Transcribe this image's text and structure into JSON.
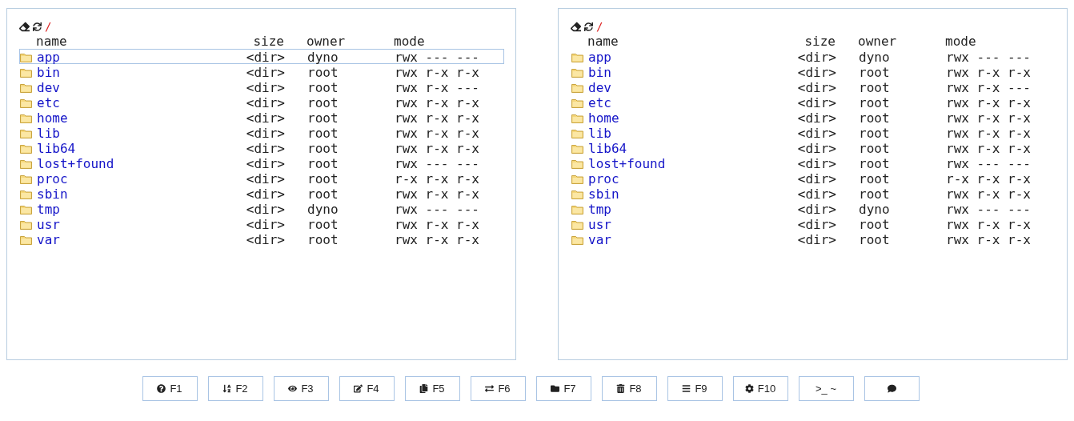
{
  "panels": [
    {
      "path": "/",
      "columns": [
        "name",
        "size",
        "owner",
        "mode"
      ],
      "rows": [
        {
          "name": "app",
          "size": "<dir>",
          "owner": "dyno",
          "mode": "rwx --- ---",
          "selected": true
        },
        {
          "name": "bin",
          "size": "<dir>",
          "owner": "root",
          "mode": "rwx r-x r-x",
          "selected": false
        },
        {
          "name": "dev",
          "size": "<dir>",
          "owner": "root",
          "mode": "rwx r-x ---",
          "selected": false
        },
        {
          "name": "etc",
          "size": "<dir>",
          "owner": "root",
          "mode": "rwx r-x r-x",
          "selected": false
        },
        {
          "name": "home",
          "size": "<dir>",
          "owner": "root",
          "mode": "rwx r-x r-x",
          "selected": false
        },
        {
          "name": "lib",
          "size": "<dir>",
          "owner": "root",
          "mode": "rwx r-x r-x",
          "selected": false
        },
        {
          "name": "lib64",
          "size": "<dir>",
          "owner": "root",
          "mode": "rwx r-x r-x",
          "selected": false
        },
        {
          "name": "lost+found",
          "size": "<dir>",
          "owner": "root",
          "mode": "rwx --- ---",
          "selected": false
        },
        {
          "name": "proc",
          "size": "<dir>",
          "owner": "root",
          "mode": "r-x r-x r-x",
          "selected": false
        },
        {
          "name": "sbin",
          "size": "<dir>",
          "owner": "root",
          "mode": "rwx r-x r-x",
          "selected": false
        },
        {
          "name": "tmp",
          "size": "<dir>",
          "owner": "dyno",
          "mode": "rwx --- ---",
          "selected": false
        },
        {
          "name": "usr",
          "size": "<dir>",
          "owner": "root",
          "mode": "rwx r-x r-x",
          "selected": false
        },
        {
          "name": "var",
          "size": "<dir>",
          "owner": "root",
          "mode": "rwx r-x r-x",
          "selected": false
        }
      ]
    },
    {
      "path": "/",
      "columns": [
        "name",
        "size",
        "owner",
        "mode"
      ],
      "rows": [
        {
          "name": "app",
          "size": "<dir>",
          "owner": "dyno",
          "mode": "rwx --- ---",
          "selected": false
        },
        {
          "name": "bin",
          "size": "<dir>",
          "owner": "root",
          "mode": "rwx r-x r-x",
          "selected": false
        },
        {
          "name": "dev",
          "size": "<dir>",
          "owner": "root",
          "mode": "rwx r-x ---",
          "selected": false
        },
        {
          "name": "etc",
          "size": "<dir>",
          "owner": "root",
          "mode": "rwx r-x r-x",
          "selected": false
        },
        {
          "name": "home",
          "size": "<dir>",
          "owner": "root",
          "mode": "rwx r-x r-x",
          "selected": false
        },
        {
          "name": "lib",
          "size": "<dir>",
          "owner": "root",
          "mode": "rwx r-x r-x",
          "selected": false
        },
        {
          "name": "lib64",
          "size": "<dir>",
          "owner": "root",
          "mode": "rwx r-x r-x",
          "selected": false
        },
        {
          "name": "lost+found",
          "size": "<dir>",
          "owner": "root",
          "mode": "rwx --- ---",
          "selected": false
        },
        {
          "name": "proc",
          "size": "<dir>",
          "owner": "root",
          "mode": "r-x r-x r-x",
          "selected": false
        },
        {
          "name": "sbin",
          "size": "<dir>",
          "owner": "root",
          "mode": "rwx r-x r-x",
          "selected": false
        },
        {
          "name": "tmp",
          "size": "<dir>",
          "owner": "dyno",
          "mode": "rwx --- ---",
          "selected": false
        },
        {
          "name": "usr",
          "size": "<dir>",
          "owner": "root",
          "mode": "rwx r-x r-x",
          "selected": false
        },
        {
          "name": "var",
          "size": "<dir>",
          "owner": "root",
          "mode": "rwx r-x r-x",
          "selected": false
        }
      ]
    }
  ],
  "buttons": [
    {
      "kind": "help",
      "label": "F1"
    },
    {
      "kind": "sort",
      "label": "F2"
    },
    {
      "kind": "view",
      "label": "F3"
    },
    {
      "kind": "edit",
      "label": "F4"
    },
    {
      "kind": "copy",
      "label": "F5"
    },
    {
      "kind": "move",
      "label": "F6"
    },
    {
      "kind": "mkdir",
      "label": "F7"
    },
    {
      "kind": "delete",
      "label": "F8"
    },
    {
      "kind": "menu",
      "label": "F9"
    },
    {
      "kind": "settings",
      "label": "F10"
    },
    {
      "kind": "terminal",
      "label": ">_ ~"
    },
    {
      "kind": "chat"
    }
  ]
}
